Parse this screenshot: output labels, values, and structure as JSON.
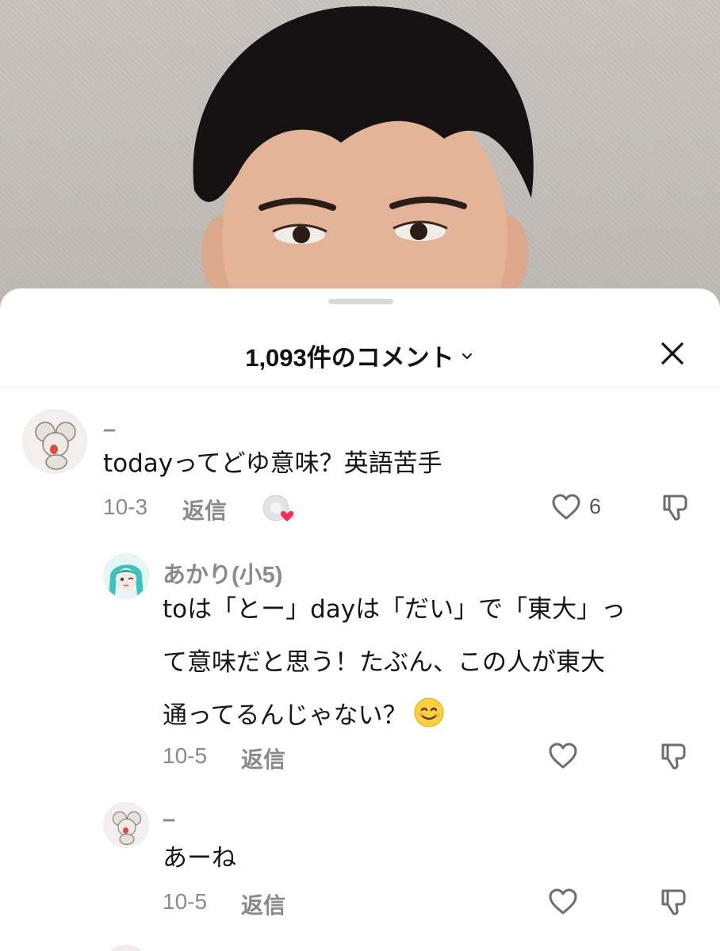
{
  "header": {
    "title": "1,093件のコメント",
    "chevron_icon": "chevron-down-icon",
    "close_icon": "close-icon"
  },
  "comments": [
    {
      "username": "–",
      "avatar_icon": "mouse-avatar",
      "text_lines": [
        "todayってどゆ意味？英語苦手"
      ],
      "date": "10-3",
      "reply_label": "返信",
      "creator_liked_icon": "creator-liked-heart-icon",
      "like_count": "6"
    },
    {
      "username": "あかり(小5)",
      "avatar_icon": "anime-girl-avatar",
      "text_lines": [
        "toは「とー」dayは「だい」で「東大」っ",
        "て意味だと思う！たぶん、この人が東大",
        "通ってるんじゃない？"
      ],
      "emoji": "smiling-face-emoji",
      "date": "10-5",
      "reply_label": "返信"
    },
    {
      "username": "–",
      "avatar_icon": "mouse-avatar",
      "text_lines": [
        "あーね"
      ],
      "date": "10-5",
      "reply_label": "返信"
    }
  ],
  "colors": {
    "muted_text": "#8a8a8a",
    "body_text": "#161616",
    "heart_red": "#fe2c55",
    "divider": "#ececec"
  }
}
